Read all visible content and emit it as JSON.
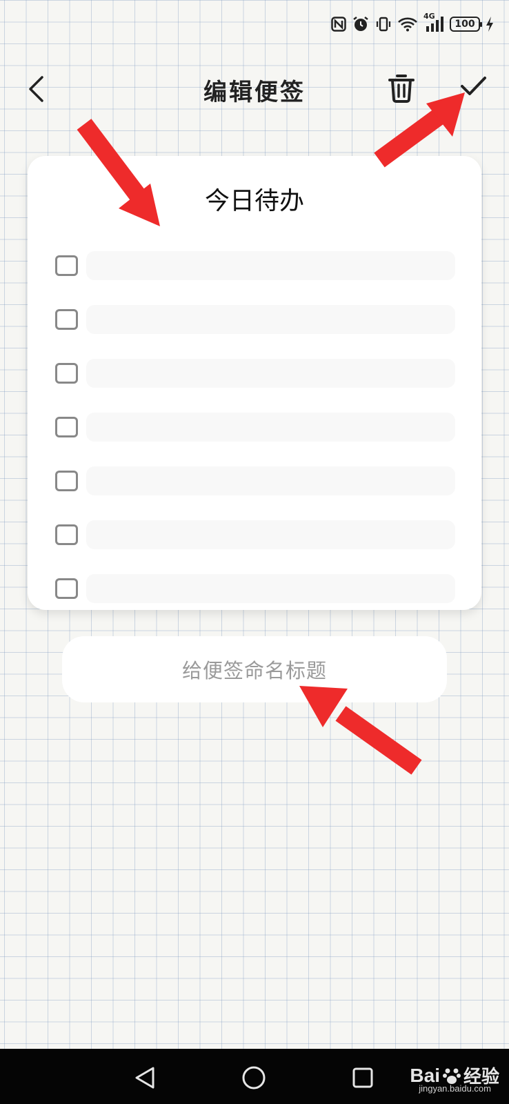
{
  "status_bar": {
    "network": "4G",
    "battery": "100"
  },
  "header": {
    "title": "编辑便签"
  },
  "card": {
    "title": "今日待办",
    "items": [
      {
        "text": ""
      },
      {
        "text": ""
      },
      {
        "text": ""
      },
      {
        "text": ""
      },
      {
        "text": ""
      },
      {
        "text": ""
      },
      {
        "text": ""
      }
    ]
  },
  "name_field": {
    "placeholder": "给便签命名标题"
  },
  "watermark": {
    "brand": "Bai",
    "brand_suffix": "经验",
    "url": "jingyan.baidu.com"
  },
  "colors": {
    "annotation_arrow": "#ee2b2b",
    "grid_line": "#96aecb"
  }
}
